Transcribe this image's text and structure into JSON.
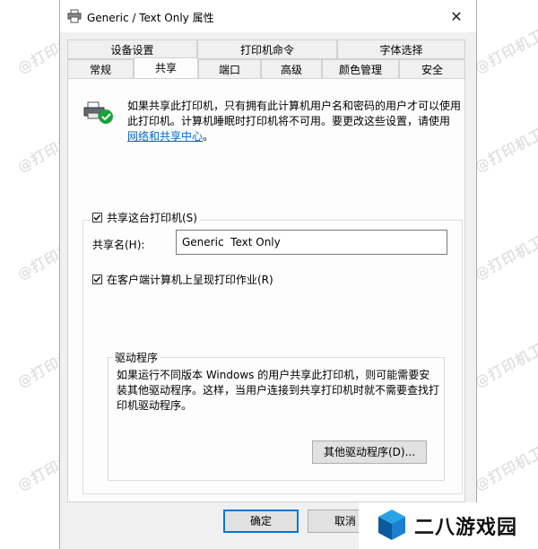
{
  "window": {
    "title": "Generic / Text Only 属性",
    "close_glyph": "✕"
  },
  "tabs_row1": [
    {
      "label": "设备设置"
    },
    {
      "label": "打印机命令"
    },
    {
      "label": "字体选择"
    }
  ],
  "tabs_row2": [
    {
      "label": "常规"
    },
    {
      "label": "共享",
      "active": true
    },
    {
      "label": "端口"
    },
    {
      "label": "高级"
    },
    {
      "label": "颜色管理"
    },
    {
      "label": "安全"
    }
  ],
  "info": {
    "text": "如果共享此打印机，只有拥有此计算机用户名和密码的用户才可以使用此打印机。计算机睡眠时打印机将不可用。要更改这些设置，请使用",
    "link": "网络和共享中心",
    "suffix": "。"
  },
  "share": {
    "checkbox_label": "共享这台打印机(S)",
    "checked": true,
    "name_label": "共享名(H):",
    "name_value": "Generic  Text Only",
    "render_jobs_label": "在客户端计算机上呈现打印作业(R)",
    "render_jobs_checked": true
  },
  "driver": {
    "legend": "驱动程序",
    "text": "如果运行不同版本 Windows 的用户共享此打印机，则可能需要安装其他驱动程序。这样，当用户连接到共享打印机时就不需要查找打印机驱动程序。",
    "button": "其他驱动程序(D)..."
  },
  "buttons": {
    "ok": "确定",
    "cancel": "取消"
  },
  "watermark_text": "@打印机卫士",
  "brand": {
    "name": "二八游戏园"
  },
  "icons": {
    "window": "printer-icon",
    "close": "close-icon",
    "shared_printer": "shared-printer-icon",
    "check": "checkmark-icon",
    "brand": "cube-logo-icon"
  },
  "colors": {
    "link": "#0a66c2",
    "accent": "#0078d7",
    "check_green": "#1aa33a"
  }
}
